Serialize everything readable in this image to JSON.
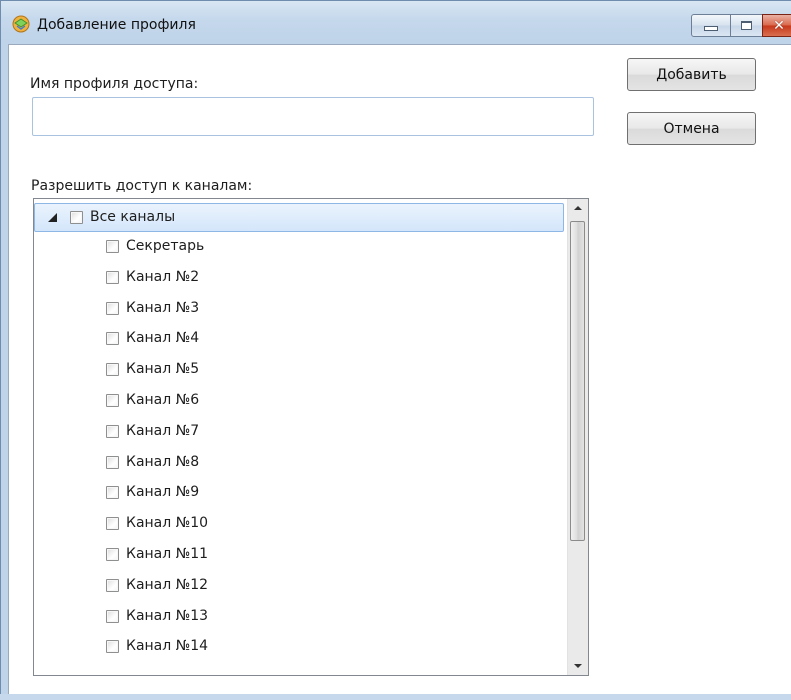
{
  "window": {
    "title": "Добавление профиля",
    "close_glyph": "✕"
  },
  "form": {
    "profile_label": "Имя профиля доступа:",
    "profile_value": "",
    "channels_label": "Разрешить доступ к каналам:"
  },
  "buttons": {
    "add": "Добавить",
    "cancel": "Отмена"
  },
  "tree": {
    "root": {
      "label": "Все каналы",
      "checked": false,
      "expanded": true,
      "selected": true
    },
    "items": [
      {
        "label": "Секретарь"
      },
      {
        "label": "Канал №2"
      },
      {
        "label": "Канал №3"
      },
      {
        "label": "Канал №4"
      },
      {
        "label": "Канал №5"
      },
      {
        "label": "Канал №6"
      },
      {
        "label": "Канал №7"
      },
      {
        "label": "Канал №8"
      },
      {
        "label": "Канал №9"
      },
      {
        "label": "Канал №10"
      },
      {
        "label": "Канал №11"
      },
      {
        "label": "Канал №12"
      },
      {
        "label": "Канал №13"
      },
      {
        "label": "Канал №14"
      }
    ]
  },
  "colors": {
    "window_frame": "#c5d8ec",
    "selection": "#d4e6fb",
    "close_button": "#c6371b"
  },
  "icons": {
    "app": "profile-app-icon",
    "expander": "expand-triangle-icon",
    "minimize": "minimize-icon",
    "maximize": "maximize-icon",
    "close": "close-icon"
  }
}
